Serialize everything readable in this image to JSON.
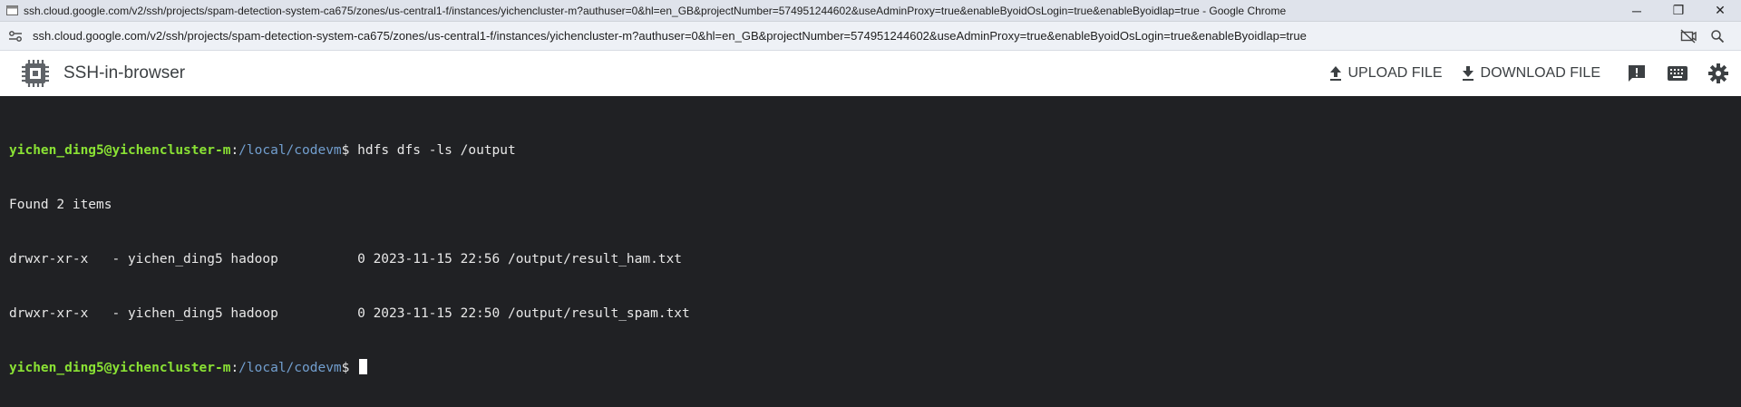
{
  "window": {
    "title": "ssh.cloud.google.com/v2/ssh/projects/spam-detection-system-ca675/zones/us-central1-f/instances/yichencluster-m?authuser=0&hl=en_GB&projectNumber=574951244602&useAdminProxy=true&enableByoidOsLogin=true&enableByoidlap=true - Google Chrome",
    "controls": {
      "minimize": "─",
      "restore": "❐",
      "close": "✕"
    }
  },
  "address": {
    "url": "ssh.cloud.google.com/v2/ssh/projects/spam-detection-system-ca675/zones/us-central1-f/instances/yichencluster-m?authuser=0&hl=en_GB&projectNumber=574951244602&useAdminProxy=true&enableByoidOsLogin=true&enableByoidlap=true"
  },
  "app": {
    "title": "SSH-in-browser",
    "upload_label": "UPLOAD FILE",
    "download_label": "DOWNLOAD FILE",
    "accent": "#3c4043"
  },
  "terminal": {
    "prompt_user": "yichen_ding5@yichencluster-m",
    "prompt_sep": ":",
    "prompt_path": "/local/codevm",
    "prompt_symbol": "$ ",
    "command": "hdfs dfs -ls /output",
    "output": [
      "Found 2 items",
      "drwxr-xr-x   - yichen_ding5 hadoop          0 2023-11-15 22:56 /output/result_ham.txt",
      "drwxr-xr-x   - yichen_ding5 hadoop          0 2023-11-15 22:50 /output/result_spam.txt"
    ],
    "colors": {
      "background": "#202124",
      "user": "#8ae234",
      "path": "#729fcf",
      "text": "#e8e8e8"
    }
  }
}
